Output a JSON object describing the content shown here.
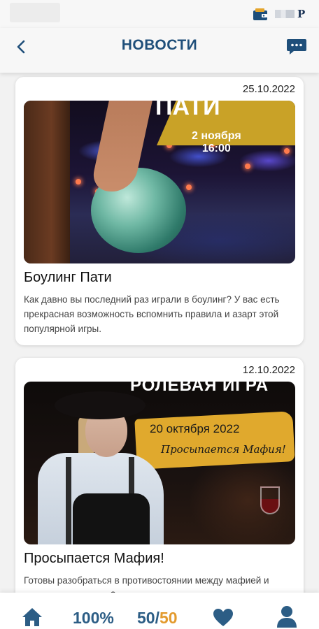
{
  "status_bar": {
    "wallet_icon": "wallet-icon",
    "right_letter": "P"
  },
  "header": {
    "title": "НОВОСТИ",
    "back_icon": "chevron-left-icon",
    "chat_icon": "chat-bubble-icon",
    "accent_color": "#1f4f7a"
  },
  "news": [
    {
      "date": "25.10.2022",
      "title": "Боулинг Пати",
      "description": "Как давно вы последний раз играли в боулинг? У вас есть прекрасная возможность вспомнить правила и азарт этой популярной игры.",
      "image": {
        "headline": "ПАТИ",
        "date_line1": "2 ноября",
        "date_line2": "16:00"
      }
    },
    {
      "date": "12.10.2022",
      "title": "Просыпается Мафия!",
      "description": "Готовы разобраться в противостоянии между мафией и мирными жителями?",
      "image": {
        "headline": "РОЛЕВАЯ ИГРА",
        "date_line": "20 октября 2022",
        "tagline": "Просыпается Мафия!"
      }
    }
  ],
  "bottom_nav": {
    "home_icon": "home-icon",
    "progress": "100%",
    "score_current": "50",
    "score_separator": "/",
    "score_total": "50",
    "heart_icon": "heart-icon",
    "profile_icon": "user-icon",
    "primary_color": "#2c5d85",
    "highlight_color": "#e39a2d"
  }
}
